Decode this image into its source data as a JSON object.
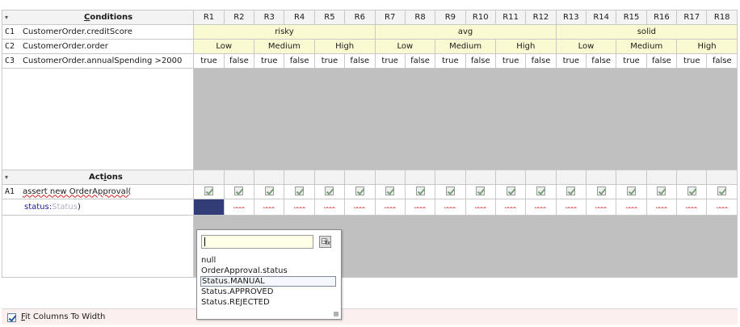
{
  "conditions_header": {
    "title": "Conditions",
    "title_mnemonic": "C",
    "title_rest": "onditions"
  },
  "rule_headers": [
    "R1",
    "R2",
    "R3",
    "R4",
    "R5",
    "R6",
    "R7",
    "R8",
    "R9",
    "R10",
    "R11",
    "R12",
    "R13",
    "R14",
    "R15",
    "R16",
    "R17",
    "R18"
  ],
  "conditions": [
    {
      "id": "C1",
      "expr": "CustomerOrder.creditScore",
      "cells": [
        {
          "text": "risky",
          "span": 6
        },
        {
          "text": "avg",
          "span": 6
        },
        {
          "text": "solid",
          "span": 6
        }
      ]
    },
    {
      "id": "C2",
      "expr": "CustomerOrder.order",
      "cells": [
        {
          "text": "Low",
          "span": 2
        },
        {
          "text": "Medium",
          "span": 2
        },
        {
          "text": "High",
          "span": 2
        },
        {
          "text": "Low",
          "span": 2
        },
        {
          "text": "Medium",
          "span": 2
        },
        {
          "text": "High",
          "span": 2
        },
        {
          "text": "Low",
          "span": 2
        },
        {
          "text": "Medium",
          "span": 2
        },
        {
          "text": "High",
          "span": 2
        }
      ]
    },
    {
      "id": "C3",
      "expr": "CustomerOrder.annualSpending >2000",
      "cells": [
        "true",
        "false",
        "true",
        "false",
        "true",
        "false",
        "true",
        "false",
        "true",
        "false",
        "true",
        "false",
        "true",
        "false",
        "true",
        "false",
        "true",
        "false"
      ]
    }
  ],
  "actions_header": {
    "title": "Actions",
    "title_prefix": "Act",
    "title_mnemonic": "i",
    "title_rest": "ons"
  },
  "actions": [
    {
      "id": "A1",
      "expr": "assert new OrderApproval(",
      "param": {
        "name": "status:",
        "placeholder": "Status",
        "close": ")"
      }
    }
  ],
  "footer": {
    "fit_label_mnemonic": "F",
    "fit_label_rest": "it Columns To Width",
    "fit_checked": true
  },
  "popup": {
    "input_value": "",
    "options": [
      "null",
      "OrderApproval.status",
      "Status.MANUAL",
      "Status.APPROVED",
      "Status.REJECTED"
    ],
    "highlighted": "Status.MANUAL"
  },
  "icons": {
    "fx": "fx-expression-icon",
    "check": "checkmark-icon",
    "sort": "sort-triangle-icon"
  },
  "colors": {
    "condition_bg": "#fafad2",
    "selected_cell": "#323d78",
    "empty_area": "#c0c0c0",
    "footer_bg": "#fbf0ee"
  }
}
